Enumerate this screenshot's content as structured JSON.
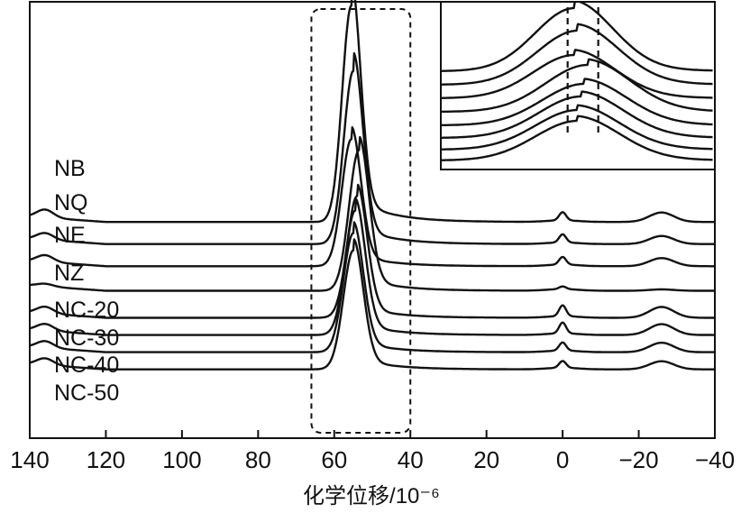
{
  "chart_data": {
    "type": "line",
    "title": "",
    "xlabel": "化学位移/10⁻⁶",
    "ylabel": "",
    "xlim": [
      140,
      -40
    ],
    "x_ticks": [
      "140",
      "120",
      "100",
      "80",
      "60",
      "40",
      "20",
      "0",
      "−20",
      "−40"
    ],
    "x_tick_values": [
      140,
      120,
      100,
      80,
      60,
      40,
      20,
      0,
      -20,
      -40
    ],
    "grid": false,
    "legend": "none",
    "offset_stacked": true,
    "highlight_box_x": [
      66,
      40
    ],
    "series": [
      {
        "name": "NB",
        "baseline": 0.88,
        "peak_x": 55.5,
        "peak_h": 0.8,
        "width": 2.4,
        "tail": 0.12,
        "p0": 0.03,
        "p25": 0.035,
        "p135": 0.03
      },
      {
        "name": "NQ",
        "baseline": 0.79,
        "peak_x": 55.0,
        "peak_h": 0.64,
        "width": 2.5,
        "tail": 0.11,
        "p0": 0.03,
        "p25": 0.03,
        "p135": 0.025
      },
      {
        "name": "NE",
        "baseline": 0.7,
        "peak_x": 55.5,
        "peak_h": 0.47,
        "width": 2.5,
        "tail": 0.1,
        "p0": 0.028,
        "p25": 0.03,
        "p135": 0.025
      },
      {
        "name": "NZ",
        "baseline": 0.6,
        "peak_x": 53.5,
        "peak_h": 0.52,
        "width": 2.6,
        "tail": 0.1,
        "p0": 0.01,
        "p25": 0.005,
        "p135": 0.01
      },
      {
        "name": "NC-20",
        "baseline": 0.49,
        "peak_x": 54.0,
        "peak_h": 0.45,
        "width": 2.6,
        "tail": 0.1,
        "p0": 0.04,
        "p25": 0.04,
        "p135": 0.025
      },
      {
        "name": "NC-30",
        "baseline": 0.42,
        "peak_x": 54.5,
        "peak_h": 0.46,
        "width": 2.6,
        "tail": 0.1,
        "p0": 0.04,
        "p25": 0.04,
        "p135": 0.025
      },
      {
        "name": "NC-40",
        "baseline": 0.35,
        "peak_x": 55.0,
        "peak_h": 0.44,
        "width": 2.6,
        "tail": 0.1,
        "p0": 0.03,
        "p25": 0.035,
        "p135": 0.025
      },
      {
        "name": "NC-50",
        "baseline": 0.28,
        "peak_x": 55.0,
        "peak_h": 0.44,
        "width": 2.6,
        "tail": 0.1,
        "p0": 0.025,
        "p25": 0.03,
        "p135": 0.025
      }
    ],
    "inset": {
      "type": "line",
      "description_visible": "zoom of peak region",
      "dashed_reference_x": [
        56.5,
        52.0
      ]
    }
  }
}
